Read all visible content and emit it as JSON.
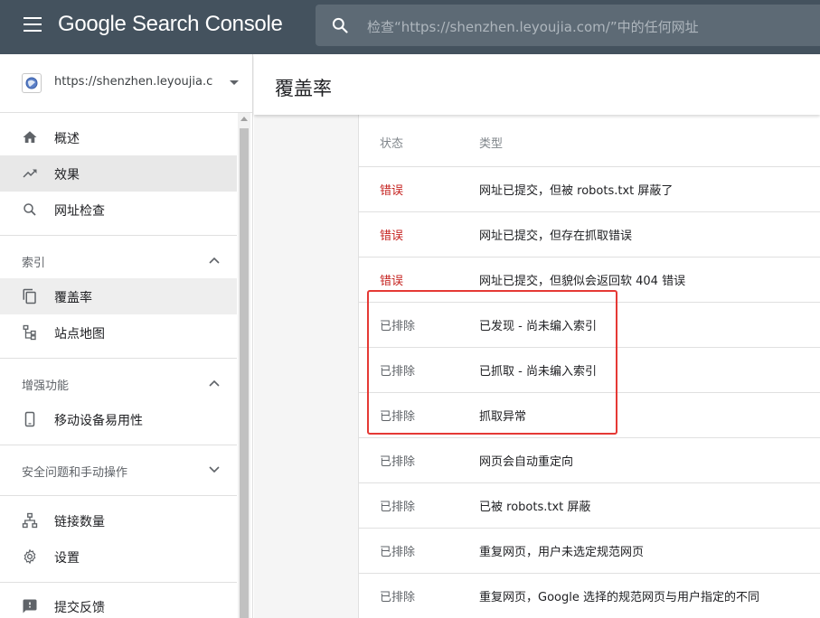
{
  "app": {
    "logo_text": "Google Search Console",
    "search_placeholder": "检查“https://shenzhen.leyoujia.com/”中的任何网址"
  },
  "sidebar": {
    "property_url": "https://shenzhen.leyoujia.com/",
    "top_items": [
      {
        "label": "概述",
        "icon": "home-icon"
      },
      {
        "label": "效果",
        "icon": "trending-up-icon"
      },
      {
        "label": "网址检查",
        "icon": "search-icon"
      }
    ],
    "sections": [
      {
        "label": "索引",
        "expanded": true,
        "items": [
          {
            "label": "覆盖率",
            "icon": "copy-pages-icon"
          },
          {
            "label": "站点地图",
            "icon": "sitemap-icon"
          }
        ]
      },
      {
        "label": "增强功能",
        "expanded": true,
        "items": [
          {
            "label": "移动设备易用性",
            "icon": "smartphone-icon"
          }
        ]
      },
      {
        "label": "安全问题和手动操作",
        "expanded": false,
        "items": []
      }
    ],
    "bottom_items": [
      {
        "label": "链接数量",
        "icon": "network-icon"
      },
      {
        "label": "设置",
        "icon": "gear-icon"
      },
      {
        "label": "提交反馈",
        "icon": "feedback-icon"
      }
    ]
  },
  "main": {
    "title": "覆盖率",
    "table": {
      "headers": [
        "状态",
        "类型"
      ],
      "rows": [
        {
          "status": "错误",
          "kind": "error",
          "type": "网址已提交，但被 robots.txt 屏蔽了"
        },
        {
          "status": "错误",
          "kind": "error",
          "type": "网址已提交，但存在抓取错误"
        },
        {
          "status": "错误",
          "kind": "error",
          "type": "网址已提交，但貌似会返回软 404 错误"
        },
        {
          "status": "已排除",
          "kind": "excluded",
          "type": "已发现 - 尚未编入索引"
        },
        {
          "status": "已排除",
          "kind": "excluded",
          "type": "已抓取 - 尚未编入索引"
        },
        {
          "status": "已排除",
          "kind": "excluded",
          "type": "抓取异常"
        },
        {
          "status": "已排除",
          "kind": "excluded",
          "type": "网页会自动重定向"
        },
        {
          "status": "已排除",
          "kind": "excluded",
          "type": "已被 robots.txt 屏蔽"
        },
        {
          "status": "已排除",
          "kind": "excluded",
          "type": "重复网页，用户未选定规范网页"
        },
        {
          "status": "已排除",
          "kind": "excluded",
          "type": "重复网页，Google 选择的规范网页与用户指定的不同"
        }
      ]
    }
  },
  "colors": {
    "topbar": "#44525e",
    "error": "#c5221f",
    "highlight_box": "#e53935"
  }
}
